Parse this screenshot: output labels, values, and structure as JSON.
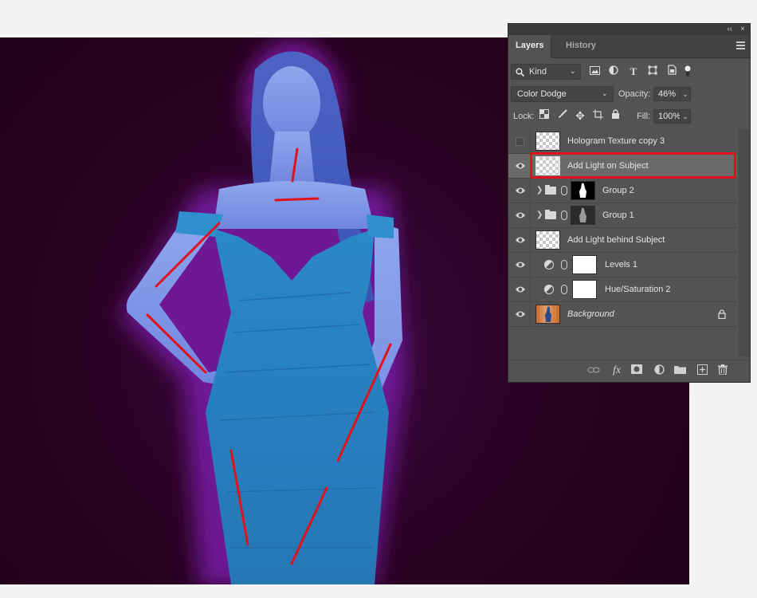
{
  "panel": {
    "collapse_glyph": "‹‹",
    "close_glyph": "×",
    "tabs": [
      {
        "label": "Layers",
        "active": true
      },
      {
        "label": "History",
        "active": false
      }
    ],
    "menu_icon": "panel-menu-icon",
    "filter": {
      "kind_label": "Kind",
      "icons": [
        "image-filter-icon",
        "adjustment-filter-icon",
        "type-filter-icon",
        "shape-filter-icon",
        "smart-object-filter-icon"
      ]
    },
    "blend": {
      "mode": "Color Dodge",
      "opacity_label": "Opacity:",
      "opacity_value": "46%"
    },
    "lock": {
      "label": "Lock:",
      "fill_label": "Fill:",
      "fill_value": "100%",
      "icons": [
        "lock-transparent-icon",
        "lock-paint-icon",
        "lock-move-icon",
        "lock-artboard-icon",
        "lock-all-icon"
      ]
    },
    "layers": [
      {
        "name": "Hologram Texture copy 3",
        "visible": false,
        "thumb": "checker"
      },
      {
        "name": "Add Light on Subject",
        "visible": true,
        "thumb": "checker",
        "selected": true
      },
      {
        "name": "Group 2",
        "visible": true,
        "type": "group"
      },
      {
        "name": "Group 1",
        "visible": true,
        "type": "group"
      },
      {
        "name": "Add Light behind Subject",
        "visible": true,
        "thumb": "checker"
      },
      {
        "name": "Levels 1",
        "visible": true,
        "type": "adjustment"
      },
      {
        "name": "Hue/Saturation 2",
        "visible": true,
        "type": "adjustment"
      },
      {
        "name": "Background",
        "visible": true,
        "type": "background",
        "locked": true
      }
    ],
    "bottom_icons": [
      "link-layers-icon",
      "fx-icon",
      "add-mask-icon",
      "new-adjustment-icon",
      "new-group-icon",
      "new-layer-icon",
      "trash-icon"
    ],
    "fx_label": "fx"
  },
  "colors": {
    "annotation_red": "#e0111b",
    "canvas_bg": "#21011a",
    "panel_bg": "#535353"
  }
}
